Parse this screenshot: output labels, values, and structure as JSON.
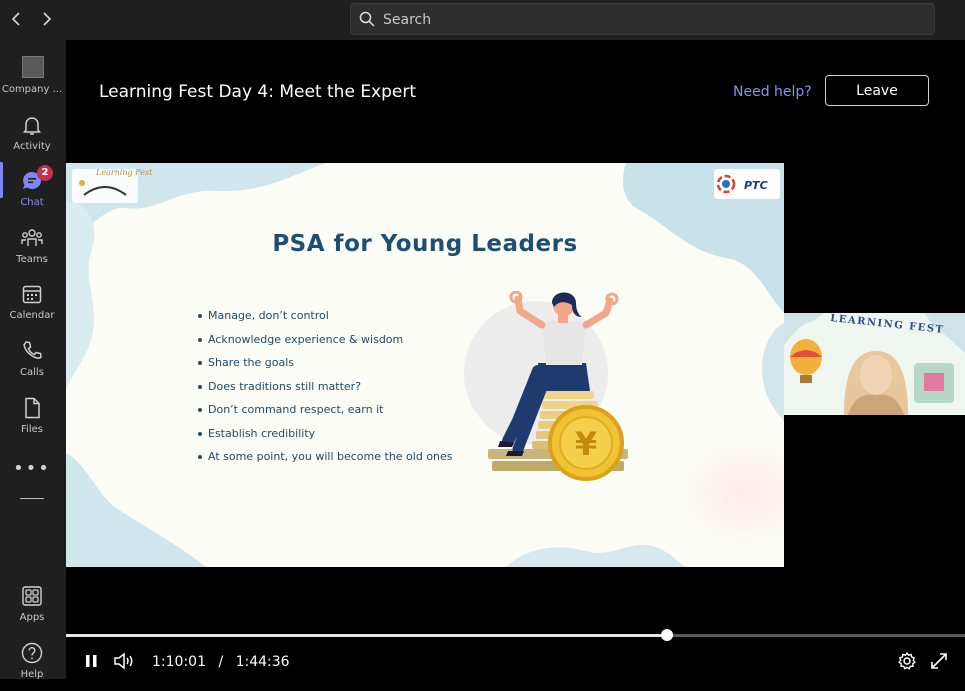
{
  "colors": {
    "accent": "#7f85f5",
    "badge": "#c4314b",
    "slide_title": "#1e4f72"
  },
  "search": {
    "placeholder": "Search"
  },
  "rail": {
    "items": [
      {
        "label": "Company ...",
        "icon": "company-logo"
      },
      {
        "label": "Activity",
        "icon": "bell-icon"
      },
      {
        "label": "Chat",
        "icon": "chat-icon",
        "badge": "2",
        "active": true
      },
      {
        "label": "Teams",
        "icon": "teams-icon"
      },
      {
        "label": "Calendar",
        "icon": "calendar-icon"
      },
      {
        "label": "Calls",
        "icon": "phone-icon"
      },
      {
        "label": "Files",
        "icon": "file-icon"
      }
    ],
    "more": "•••",
    "apps": "Apps",
    "help": "Help"
  },
  "meeting": {
    "title": "Learning Fest Day 4: Meet the Expert",
    "help_link": "Need help?",
    "leave_label": "Leave"
  },
  "slide": {
    "title": "PSA for Young Leaders",
    "logo_left_text": "Learning Fest",
    "logo_right_text": "PTC",
    "bullets": [
      "Manage, don’t control",
      "Acknowledge experience & wisdom",
      "Share the goals",
      "Does traditions still matter?",
      "Don’t command respect, earn it",
      "Establish credibility",
      "At some point, you will become the old ones"
    ]
  },
  "thumbnail": {
    "banner_text": "LEARNING FEST"
  },
  "player": {
    "current_time": "1:10:01",
    "separator": "/",
    "duration": "1:44:36",
    "progress": 0.669
  }
}
